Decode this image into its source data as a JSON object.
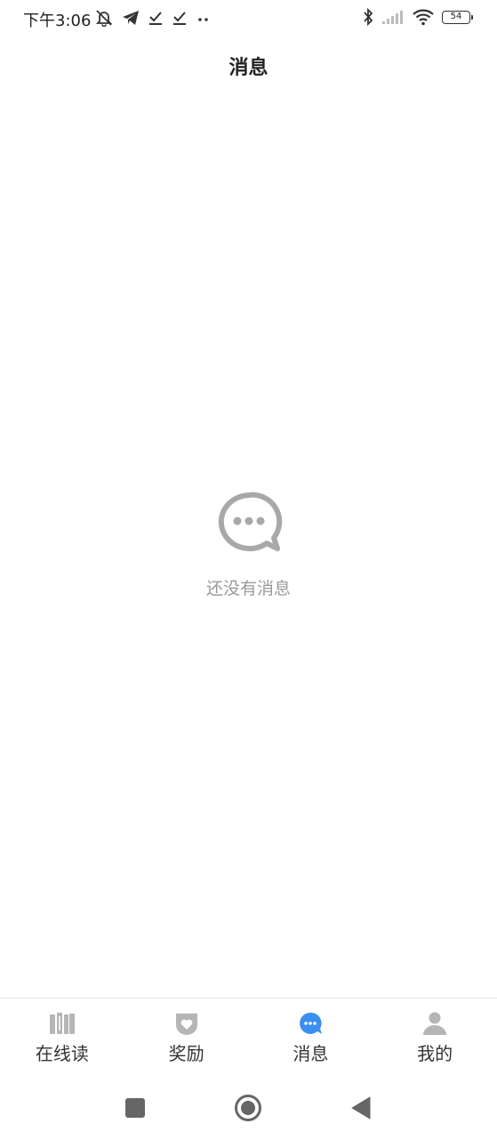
{
  "status_bar": {
    "time": "下午3:06",
    "battery": "54",
    "icons_left": [
      "mute-bell-icon",
      "telegram-icon",
      "check-icon",
      "check-icon",
      "more-dots-icon"
    ],
    "icons_right": [
      "bluetooth-icon",
      "signal-icon",
      "wifi-icon",
      "battery-icon"
    ]
  },
  "header": {
    "title": "消息"
  },
  "empty_state": {
    "icon": "chat-bubble-icon",
    "text": "还没有消息"
  },
  "tabs": [
    {
      "label": "在线读",
      "icon": "books-icon",
      "active": false
    },
    {
      "label": "奖励",
      "icon": "reward-badge-icon",
      "active": false
    },
    {
      "label": "消息",
      "icon": "message-icon",
      "active": true
    },
    {
      "label": "我的",
      "icon": "user-icon",
      "active": false
    }
  ],
  "colors": {
    "active_tab": "#3b8ff0",
    "inactive_icon": "#b5b5b5",
    "empty_icon": "#a8a8a8",
    "empty_text": "#9a9a9a"
  },
  "nav": [
    "recents-square-icon",
    "home-circle-icon",
    "back-triangle-icon"
  ]
}
